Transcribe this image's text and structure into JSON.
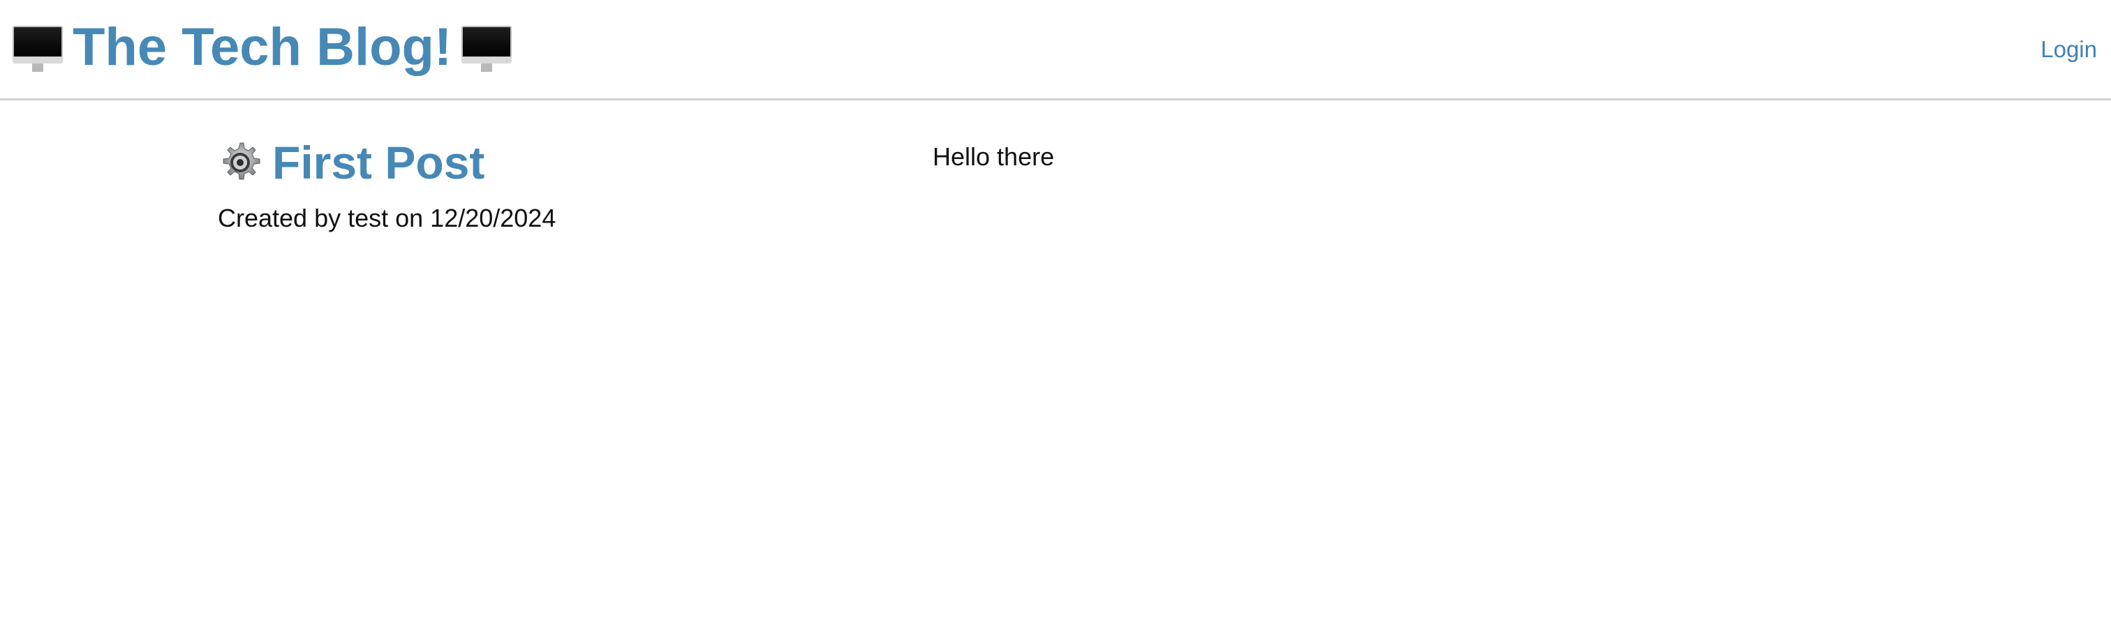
{
  "header": {
    "title": "The Tech Blog!",
    "left_icon": "desktop-computer-icon",
    "right_icon": "desktop-computer-icon",
    "login_label": "Login"
  },
  "post": {
    "icon": "gear-icon",
    "title": "First Post",
    "meta": "Created by test on 12/20/2024",
    "content": "Hello there"
  },
  "colors": {
    "accent": "#4688b6",
    "link": "#3f82b4",
    "divider": "#d2d2d2",
    "text": "#111111"
  }
}
